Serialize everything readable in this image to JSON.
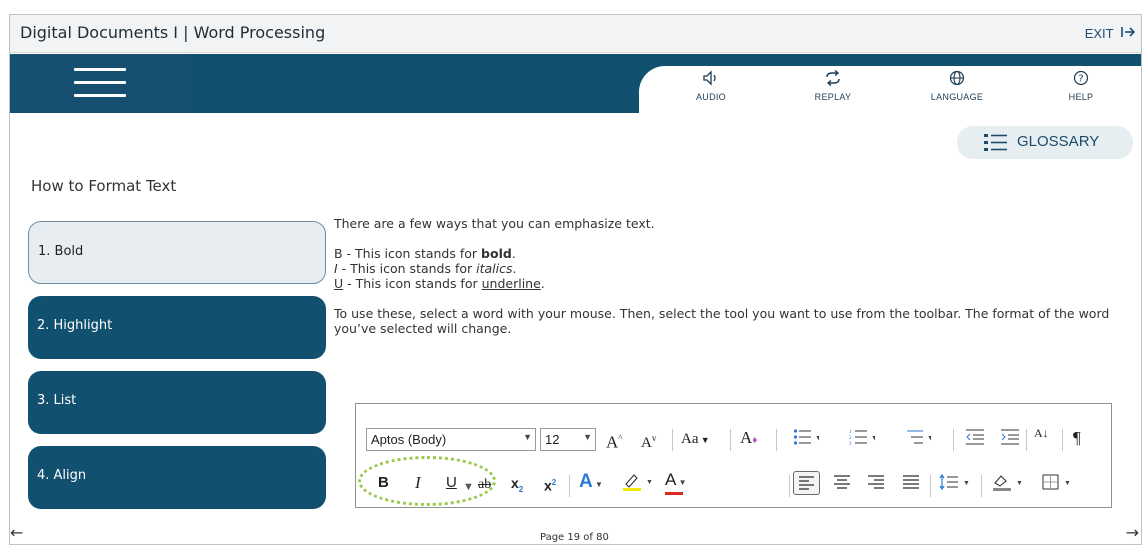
{
  "window": {
    "title": "Digital Documents I | Word Processing",
    "exit_label": "EXIT",
    "exit_icon": "exit-arrow-icon"
  },
  "nav": {
    "menu_icon": "hamburger-menu-icon",
    "tools": [
      {
        "label": "AUDIO",
        "icon": "speaker-icon"
      },
      {
        "label": "REPLAY",
        "icon": "replay-icon"
      },
      {
        "label": "LANGUAGE",
        "icon": "globe-icon"
      },
      {
        "label": "HELP",
        "icon": "help-icon"
      }
    ]
  },
  "glossary": {
    "label": "GLOSSARY",
    "icon": "list-icon"
  },
  "lesson": {
    "title": "How to Format Text",
    "steps": [
      {
        "label": "1. Bold",
        "active": true
      },
      {
        "label": "2. Highlight",
        "active": false
      },
      {
        "label": "3. List",
        "active": false
      },
      {
        "label": "4. Align",
        "active": false
      }
    ]
  },
  "content": {
    "intro": "There are a few ways that you can emphasize text.",
    "items": [
      {
        "key": "B",
        "prefix": " - This icon stands for ",
        "word": "bold",
        "suffix": "."
      },
      {
        "key": "I",
        "prefix": " - This icon stands for ",
        "word": "italics",
        "suffix": "."
      },
      {
        "key": "U",
        "prefix": " - This icon stands for ",
        "word": "underline",
        "suffix": "."
      }
    ],
    "instructions": "To use these, select a word with your mouse. Then, select the tool you want to use from the toolbar. The format of the word you’ve selected will change."
  },
  "ribbon": {
    "font_name": "Aptos (Body)",
    "font_size": "12",
    "grow_label": "A",
    "shrink_label": "A",
    "case_label": "Aa",
    "bold_label": "B",
    "italic_label": "I",
    "underline_label": "U",
    "strike_label": "ab",
    "subscript_label": "x",
    "superscript_label": "x",
    "text_effects_label": "A",
    "font_color_label": "A",
    "sort_label": "A↓",
    "pilcrow_label": "¶",
    "highlight_color": "#9ac94a",
    "highlighter_color": "#f2e600",
    "font_color": "#e0281e",
    "text_effect_color": "#2b79d6"
  },
  "footer": {
    "page_text": "Page 19 of 80"
  },
  "colors": {
    "nav": "#11506e",
    "accent": "#1d4b69",
    "active_bg": "#e8edf1"
  }
}
